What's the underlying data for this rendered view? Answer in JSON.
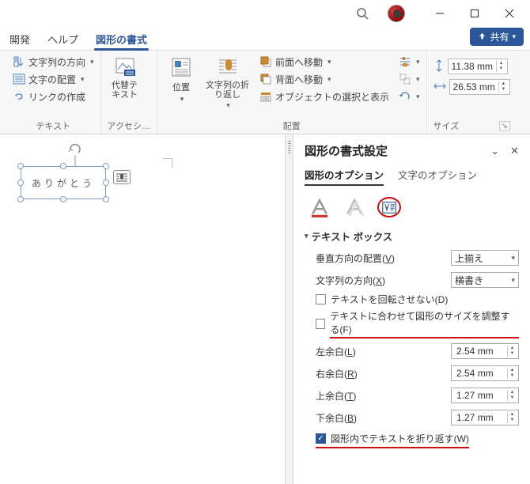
{
  "titlebar": {
    "min": "min",
    "max": "max",
    "close": "close"
  },
  "tabs": {
    "dev": "開発",
    "help": "ヘルプ",
    "shapefmt": "図形の書式",
    "share": "共有"
  },
  "ribbon": {
    "text": {
      "dir": "文字列の方向",
      "align": "文字の配置",
      "link": "リンクの作成",
      "label": "テキスト"
    },
    "acc": {
      "alt": "代替テ\nキスト",
      "label": "アクセシ…"
    },
    "arr": {
      "pos": "位置",
      "wrap": "文字列の折\nり返し",
      "front": "前面へ移動",
      "back": "背面へ移動",
      "sel": "オブジェクトの選択と表示",
      "label": "配置"
    },
    "size": {
      "h": "11.38 mm",
      "w": "26.53 mm",
      "label": "サイズ"
    }
  },
  "canvas": {
    "text": "ありがとう"
  },
  "panel": {
    "title": "図形の書式設定",
    "tab1": "図形のオプション",
    "tab2": "文字のオプション",
    "section": "テキスト ボックス",
    "valign_lbl": "垂直方向の配置",
    "valign_accel": "V",
    "valign_val": "上揃え",
    "dir_lbl": "文字列の方向",
    "dir_accel": "X",
    "dir_val": "横書き",
    "chk_rot": "テキストを回転させない",
    "chk_rot_accel": "D",
    "chk_fit": "テキストに合わせて図形のサイズを調整する",
    "chk_fit_accel": "F",
    "ml_lbl": "左余白",
    "ml_accel": "L",
    "ml_val": "2.54 mm",
    "mr_lbl": "右余白",
    "mr_accel": "R",
    "mr_val": "2.54 mm",
    "mt_lbl": "上余白",
    "mt_accel": "T",
    "mt_val": "1.27 mm",
    "mb_lbl": "下余白",
    "mb_accel": "B",
    "mb_val": "1.27 mm",
    "chk_wrap": "図形内でテキストを折り返す",
    "chk_wrap_accel": "W"
  }
}
